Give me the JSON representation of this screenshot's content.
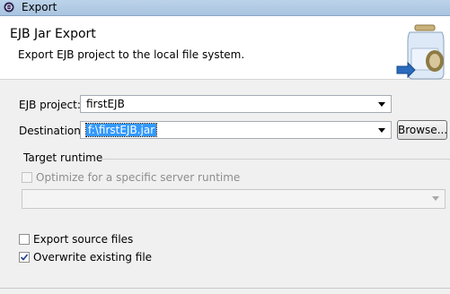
{
  "window": {
    "title": "Export"
  },
  "header": {
    "title": "EJB Jar Export",
    "description": "Export EJB project to the local file system."
  },
  "form": {
    "project_label": "EJB project:",
    "project_value": "firstEJB",
    "destination_label": "Destination:",
    "destination_value": "f:\\firstEJB.jar",
    "browse_label": "Browse..."
  },
  "target_runtime": {
    "group_label": "Target runtime",
    "optimize_label": "Optimize for a specific server runtime",
    "optimize_checked": false,
    "runtime_value": ""
  },
  "options": {
    "export_source_label": "Export source files",
    "export_source_checked": false,
    "overwrite_label": "Overwrite existing file",
    "overwrite_checked": true
  },
  "colors": {
    "accent": "#3399ff",
    "titlebar": "#bcd3ea",
    "dialog_bg": "#f0f0f0"
  }
}
